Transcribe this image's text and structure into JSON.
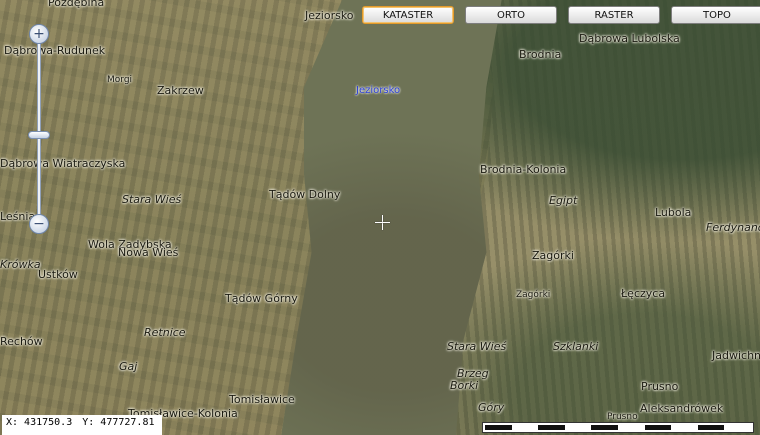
{
  "toolbar": {
    "buttons": [
      {
        "label": "KATASTER",
        "active": true
      },
      {
        "label": "ORTO",
        "active": false
      },
      {
        "label": "RASTER",
        "active": false
      },
      {
        "label": "TOPO",
        "active": false
      }
    ]
  },
  "zoom": {
    "plus_icon": "zoom-in-icon",
    "minus_icon": "zoom-out-icon",
    "level_fraction": 0.52
  },
  "coordinates": {
    "x": "X: 431750.3",
    "y": "Y: 477727.81"
  },
  "places": {
    "pozdebina": "Pozdębina",
    "jeziorsko_top": "Jeziorsko",
    "dabrowa_lubolska": "Dąbrowa Lubolska",
    "brodnia": "Brodnia",
    "dabrowa_rudunek": "Dąbrowa-Rudunek",
    "morgi": "Morgi",
    "zakrzew": "Zakrzew",
    "jeziorsko_blue": "Jeziorsko",
    "dabrowa_wiatraczyska": "Dąbrowa Wiatraczyska",
    "brodnia_kolonia": "Brodnia-Kolonia",
    "tadow_dolny": "Tądów Dolny",
    "stara_wies_left": "Stara Wieś",
    "egipt": "Egipt",
    "lubola": "Lubola",
    "lesnia": "Leśnia",
    "ferdynandow": "Ferdynandów",
    "wola_zadybska": "Wola Zadybska",
    "nowa_wies": "Nowa Wieś",
    "zagorki_1": "Zagórki",
    "krowka": "Krówka",
    "ustkow": "Ustków",
    "zagorki_2": "Zagórki",
    "leczyca": "Łęczyca",
    "tadow_gorny": "Tądów Górny",
    "retnice": "Retnice",
    "rechow": "Rechów",
    "stara_wies_right": "Stara Wieś",
    "szklanki": "Szklanki",
    "jadwichna": "Jadwichna",
    "gaj": "Gaj",
    "brzeg": "Brzeg",
    "borki": "Borki",
    "prusno": "Prusno",
    "tomislawice": "Tomisławice",
    "gory": "Góry",
    "aleksandrowek": "Aleksandrówek",
    "tomislawice_kolonia": "Tomisławice-Kolonia",
    "prusno_small": "Prusno"
  }
}
